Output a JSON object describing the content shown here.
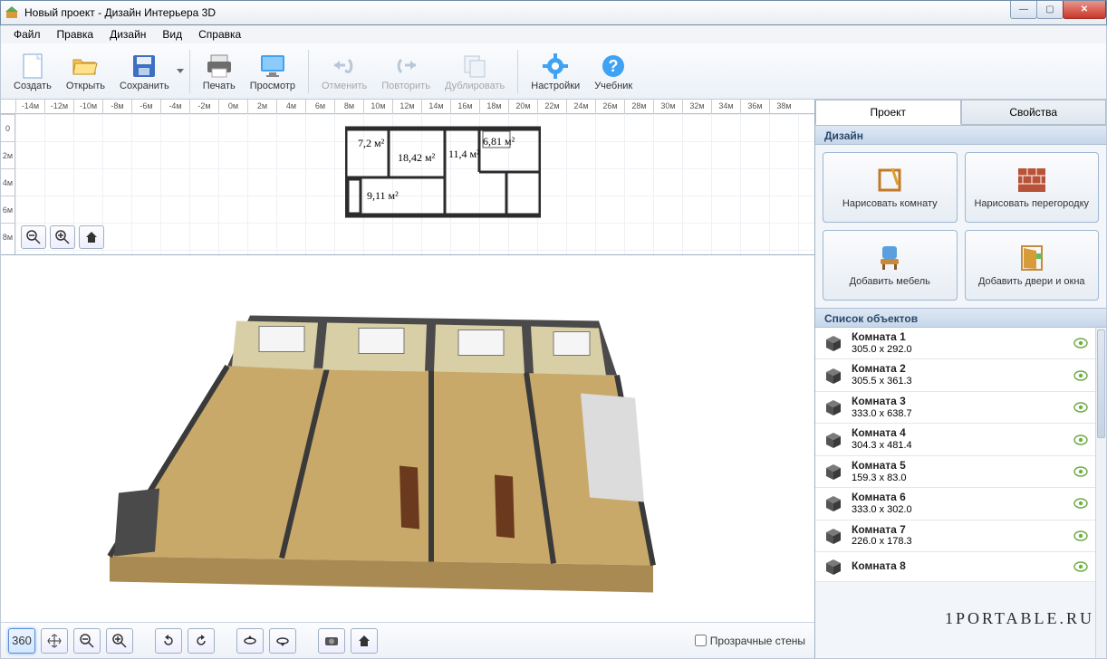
{
  "window": {
    "title": "Новый проект - Дизайн Интерьера 3D"
  },
  "menu": [
    "Файл",
    "Правка",
    "Дизайн",
    "Вид",
    "Справка"
  ],
  "toolbar": {
    "create": "Создать",
    "open": "Открыть",
    "save": "Сохранить",
    "print": "Печать",
    "preview": "Просмотр",
    "undo": "Отменить",
    "redo": "Повторить",
    "duplicate": "Дублировать",
    "settings": "Настройки",
    "help": "Учебник"
  },
  "ruler_h": [
    "-14м",
    "-12м",
    "-10м",
    "-8м",
    "-6м",
    "-4м",
    "-2м",
    "0м",
    "2м",
    "4м",
    "6м",
    "8м",
    "10м",
    "12м",
    "14м",
    "16м",
    "18м",
    "20м",
    "22м",
    "24м",
    "26м",
    "28м",
    "30м",
    "32м",
    "34м",
    "36м",
    "38м"
  ],
  "ruler_v": [
    "0",
    "2м",
    "4м",
    "6м",
    "8м"
  ],
  "floorplan_labels": {
    "a": "7,2 м²",
    "b": "18,42 м²",
    "c": "11,4 м²",
    "d": "6,81 м²",
    "e": "9,11 м²"
  },
  "bottom": {
    "transparent_walls": "Прозрачные стены",
    "deg": "360"
  },
  "tabs": {
    "project": "Проект",
    "properties": "Свойства"
  },
  "sections": {
    "design": "Дизайн",
    "objects": "Список объектов"
  },
  "design_buttons": {
    "draw_room": "Нарисовать комнату",
    "draw_wall": "Нарисовать перегородку",
    "add_furn": "Добавить мебель",
    "add_doors": "Добавить двери и окна"
  },
  "objects": [
    {
      "name": "Комната 1",
      "size": "305.0 x 292.0"
    },
    {
      "name": "Комната 2",
      "size": "305.5 x 361.3"
    },
    {
      "name": "Комната 3",
      "size": "333.0 x 638.7"
    },
    {
      "name": "Комната 4",
      "size": "304.3 x 481.4"
    },
    {
      "name": "Комната 5",
      "size": "159.3 x 83.0"
    },
    {
      "name": "Комната 6",
      "size": "333.0 x 302.0"
    },
    {
      "name": "Комната 7",
      "size": "226.0 x 178.3"
    },
    {
      "name": "Комната 8",
      "size": ""
    }
  ],
  "watermark": "1PORTABLE.RU"
}
